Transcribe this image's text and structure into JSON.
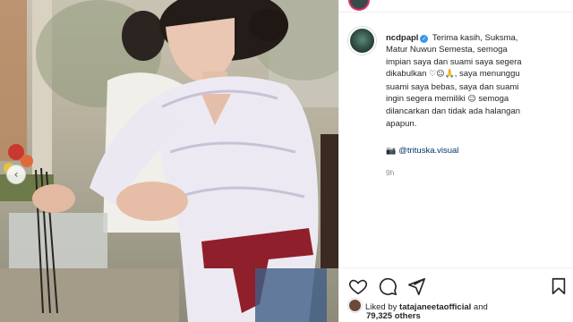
{
  "post": {
    "username": "ncdpapl",
    "verified_glyph": "✓",
    "caption_lines": [
      "Terima kasih, Suksma,",
      "Matur Nuwun Semesta, semoga",
      "impian saya dan suami saya segera",
      "dikabulkan",
      ", saya menunggu",
      "suami saya bebas, saya dan suami",
      "ingin segera memiliki",
      "semoga",
      "dilancarkan dan tidak ada halangan",
      "apapun."
    ],
    "emojis": {
      "heart": "♡",
      "smile": "☺",
      "pray": "🙏",
      "baby": "☺"
    },
    "credit_icon": "camera-icon",
    "credit_glyph": "📷",
    "credit_handle": "@trituska.visual",
    "time_ago": "9h"
  },
  "actions": {
    "like": "heart-icon",
    "comment": "comment-icon",
    "share": "paper-plane-icon",
    "save": "bookmark-icon"
  },
  "likes": {
    "prefix": "Liked by",
    "user": "tatajaneetaofficial",
    "conjunction": "and",
    "count": "79,325 others"
  },
  "colors": {
    "verified": "#3897f0",
    "link": "#00376b",
    "muted": "#8e8e8e",
    "story_ring": "#e1306c"
  },
  "carousel": {
    "prev_glyph": "‹"
  }
}
